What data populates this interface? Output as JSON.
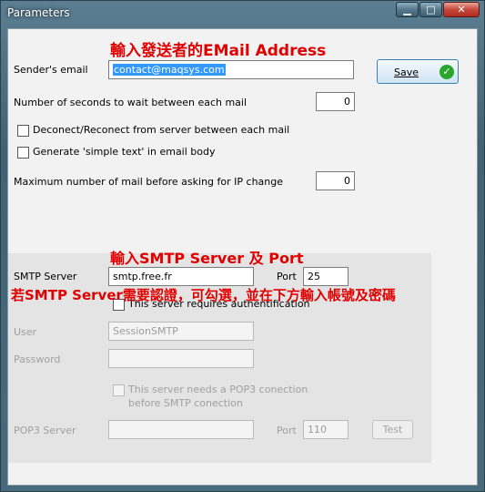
{
  "window": {
    "title": "Parameters",
    "minimize_glyph": "▁",
    "maximize_glyph": "□",
    "close_glyph": "✕"
  },
  "annotations": {
    "sender": "輸入發送者的EMail Address",
    "smtp": "輸入SMTP Server 及 Port",
    "auth": "若SMTP Server需要認證，可勾選，並在下方輸入帳號及密碼"
  },
  "form": {
    "senders_email_label": "Sender's email",
    "senders_email_value": "contact@maqsys.com",
    "wait_label": "Number of seconds to wait between each mail",
    "wait_value": "0",
    "reconnect_label": "Deconect/Reconect from server between each mail",
    "simple_text_label": "Generate 'simple text' in email body",
    "max_mail_label": "Maximum number of mail before asking for IP change",
    "max_mail_value": "0"
  },
  "save_button": {
    "label": "Save",
    "icon": "check-icon"
  },
  "smtp": {
    "server_label": "SMTP Server",
    "server_value": "smtp.free.fr",
    "port_label": "Port",
    "port_value": "25",
    "auth_label": "This server requires authentification",
    "user_label": "User",
    "user_value": "SessionSMTP",
    "password_label": "Password",
    "password_value": "",
    "pop3_label_line1": "This server needs a POP3 conection",
    "pop3_label_line2": "before SMTP conection",
    "pop3_server_label": "POP3 Server",
    "pop3_server_value": "",
    "pop3_port_label": "Port",
    "pop3_port_value": "110",
    "test_label": "Test"
  },
  "colors": {
    "annotation_red": "#e10000",
    "selection_blue": "#3399ff",
    "save_check_green": "#2aa52e"
  }
}
